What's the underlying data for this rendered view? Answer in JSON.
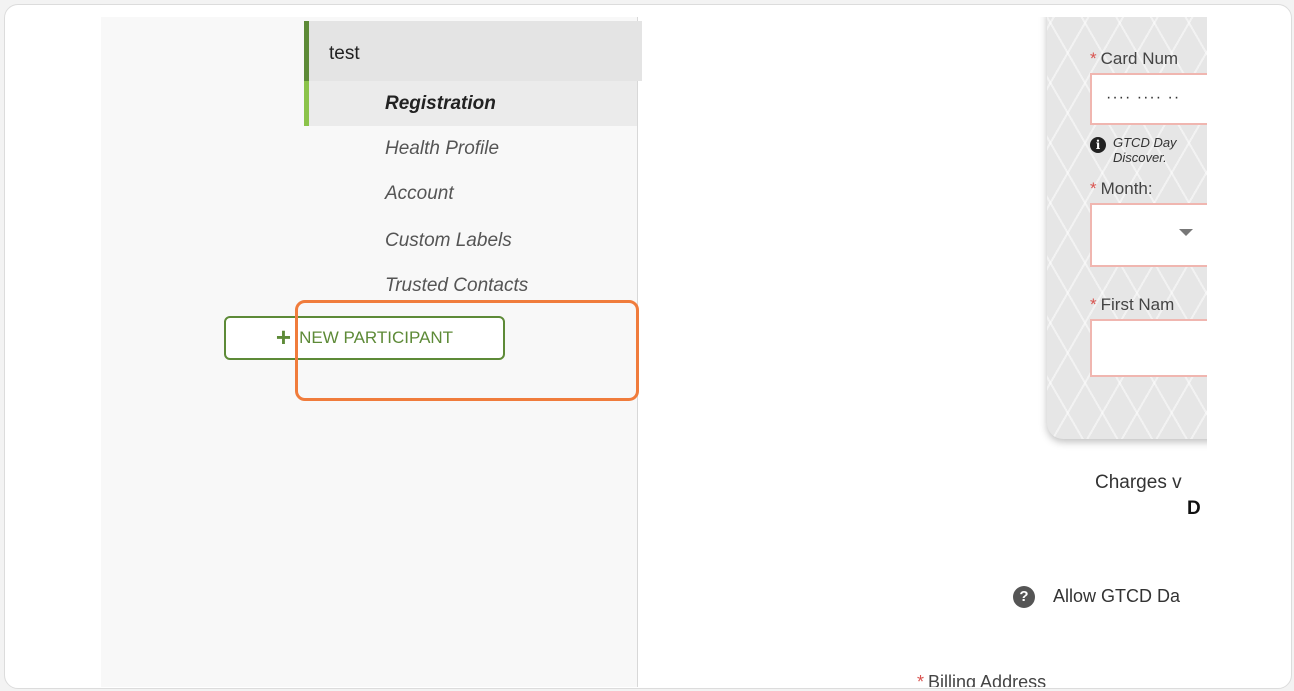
{
  "sidebar": {
    "participant_name": "test",
    "items": [
      {
        "label": "Registration",
        "active": true
      },
      {
        "label": "Health Profile",
        "active": false
      },
      {
        "label": "Account",
        "active": false
      },
      {
        "label": "Custom Labels",
        "active": false
      },
      {
        "label": "Trusted Contacts",
        "active": false
      }
    ],
    "new_participant_icon": "+",
    "new_participant_label": "NEW PARTICIPANT"
  },
  "payment": {
    "card_number_label": "Card Num",
    "card_number_value": "···· ···· ··",
    "card_note_line1": "GTCD Day",
    "card_note_line2": "Discover.",
    "month_label": "Month:",
    "first_name_label": "First Nam",
    "charges_text": "Charges v",
    "charges_strong": "D",
    "allow_text": "Allow GTCD Da",
    "billing_label": "Billing Address",
    "required_marker": "*"
  },
  "colors": {
    "accent_green": "#5d8a37",
    "active_bar": "#8bc34a",
    "highlight_orange": "#f07c3c",
    "required_red": "#d9534f"
  },
  "icons": {
    "info": "info-circle-icon",
    "help": "question-circle-icon",
    "caret": "caret-down-icon",
    "plus": "plus-icon"
  }
}
